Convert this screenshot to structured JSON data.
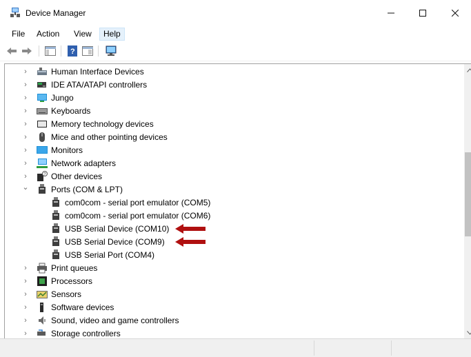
{
  "window": {
    "title": "Device Manager"
  },
  "menu": {
    "file": "File",
    "action": "Action",
    "view": "View",
    "help": "Help"
  },
  "tree": {
    "items": [
      {
        "label": "Human Interface Devices",
        "expander": "›",
        "icon": "hid-icon"
      },
      {
        "label": "IDE ATA/ATAPI controllers",
        "expander": "›",
        "icon": "ide-controller-icon"
      },
      {
        "label": "Jungo",
        "expander": "›",
        "icon": "jungo-monitor-icon"
      },
      {
        "label": "Keyboards",
        "expander": "›",
        "icon": "keyboard-icon"
      },
      {
        "label": "Memory technology devices",
        "expander": "›",
        "icon": "memory-device-icon"
      },
      {
        "label": "Mice and other pointing devices",
        "expander": "›",
        "icon": "mouse-icon"
      },
      {
        "label": "Monitors",
        "expander": "›",
        "icon": "monitor-icon"
      },
      {
        "label": "Network adapters",
        "expander": "›",
        "icon": "network-adapter-icon"
      },
      {
        "label": "Other devices",
        "expander": "›",
        "icon": "unknown-device-icon"
      },
      {
        "label": "Ports (COM & LPT)",
        "expander": "⌄",
        "icon": "port-icon"
      },
      {
        "label": "com0com - serial port emulator (COM5)",
        "icon": "port-icon"
      },
      {
        "label": "com0com - serial port emulator (COM6)",
        "icon": "port-icon"
      },
      {
        "label": "USB Serial Device (COM10)",
        "icon": "port-icon"
      },
      {
        "label": "USB Serial Device (COM9)",
        "icon": "port-icon"
      },
      {
        "label": "USB Serial Port (COM4)",
        "icon": "port-icon"
      },
      {
        "label": "Print queues",
        "expander": "›",
        "icon": "printer-icon"
      },
      {
        "label": "Processors",
        "expander": "›",
        "icon": "processor-icon"
      },
      {
        "label": "Sensors",
        "expander": "›",
        "icon": "sensor-icon"
      },
      {
        "label": "Software devices",
        "expander": "›",
        "icon": "software-device-icon"
      },
      {
        "label": "Sound, video and game controllers",
        "expander": "›",
        "icon": "speaker-icon"
      },
      {
        "label": "Storage controllers",
        "expander": "›",
        "icon": "storage-controller-icon"
      }
    ]
  },
  "annotation": {
    "color": "#b01010"
  },
  "colors": {
    "accent": "#0078d7",
    "monitor_blue": "#1e8fd6"
  }
}
